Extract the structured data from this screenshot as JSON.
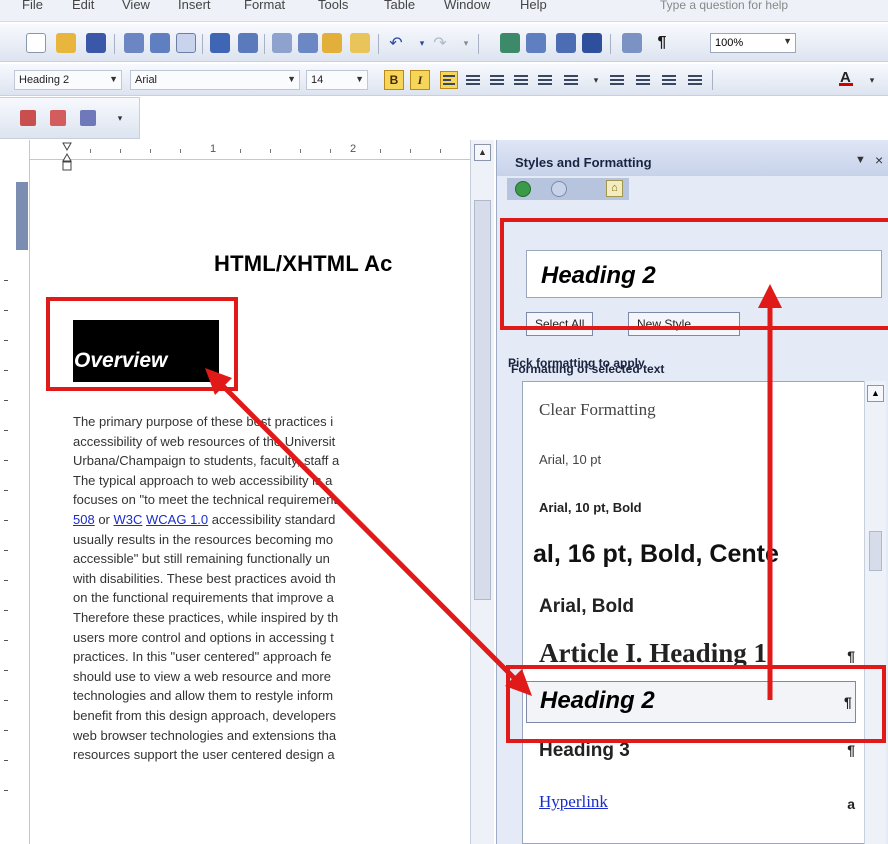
{
  "menubar": {
    "items": [
      "File",
      "Edit",
      "View",
      "Insert",
      "Format",
      "Tools",
      "Table",
      "Window",
      "Help"
    ],
    "help_box": "Type a question for help"
  },
  "toolbar": {
    "zoom": "100%",
    "style_value": "Heading 2",
    "font_value": "Arial",
    "size_value": "14",
    "bold_label": "B",
    "italic_label": "I",
    "font_color_label": "A"
  },
  "ruler": {
    "numbers": [
      "1",
      "2"
    ]
  },
  "document": {
    "title": "HTML/XHTML Ac",
    "heading": "Overview",
    "body_lines": [
      "The primary purpose of these best practices i",
      "accessibility of web resources of the Universit",
      "Urbana/Champaign to students, faculty, staff a",
      "The typical approach to web accessibility is a",
      "focuses on \"to meet the technical requirement",
      "usually results in the resources becoming mo",
      "accessible\" but still remaining functionally un",
      "with disabilities. These best practices avoid th",
      "on the functional requirements that improve a",
      "Therefore these practices, while inspired by th",
      "users more control and options in accessing t",
      "practices. In this \"user centered\" approach fe",
      "should use to view a web resource and more",
      "technologies and allow them to restyle inform",
      "benefit from this design approach, developers",
      "web browser technologies and extensions tha",
      "resources support the user centered design a"
    ],
    "link_line": {
      "link1": "508",
      "or": " or ",
      "link2": "W3C",
      "space": " ",
      "link3": "WCAG 1.0",
      "rest": " accessibility standard"
    }
  },
  "task_pane": {
    "title": "Styles and Formatting",
    "menu_arrow": "▼",
    "close": "×",
    "selected_label": "Formatting of selected text",
    "selected_value": "Heading 2",
    "select_all": "Select All",
    "new_style": "New Style...",
    "pick_label": "Pick formatting to apply",
    "styles": [
      {
        "label": "Clear Formatting",
        "mark": ""
      },
      {
        "label": "Arial, 10 pt",
        "mark": ""
      },
      {
        "label": "Arial, 10 pt, Bold",
        "mark": ""
      },
      {
        "label": "al, 16 pt, Bold, Cente",
        "mark": ""
      },
      {
        "label": "Arial, Bold",
        "mark": ""
      },
      {
        "label": "Article I.  Heading 1",
        "mark": "¶"
      },
      {
        "label": "Heading 2",
        "mark": "¶"
      },
      {
        "label": "Heading 3",
        "mark": "¶"
      },
      {
        "label": "Hyperlink",
        "mark": "a"
      }
    ]
  },
  "annotation_color": "#e01919"
}
